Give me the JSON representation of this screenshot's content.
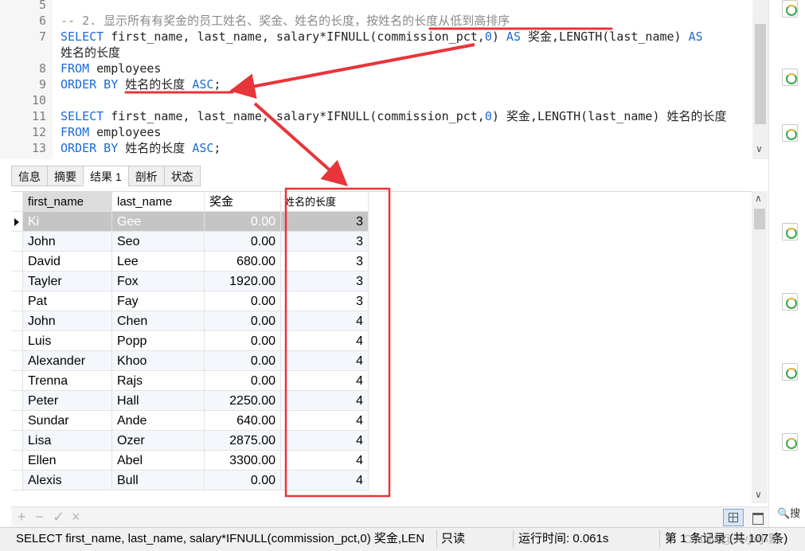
{
  "editor": {
    "lines": [
      {
        "num": "5"
      },
      {
        "num": "6",
        "comment": "-- 2. 显示所有有奖金的员工姓名、奖金、姓名的长度，按姓名的长度从低到高排序"
      },
      {
        "num": "7",
        "kw1": "SELECT",
        "t1": " first_name, last_name, salary*IFNULL(commission_pct,",
        "n1": "0",
        "t2": ") ",
        "kw2": "AS",
        "t3": " 奖金,LENGTH(last_name) ",
        "kw3": "AS"
      },
      {
        "wrap": "姓名的长度"
      },
      {
        "num": "8",
        "kw1": "FROM",
        "t1": " employees"
      },
      {
        "num": "9",
        "kw1": "ORDER BY",
        "t1": " 姓名的长度 ",
        "kw2": "ASC",
        "t2": ";"
      },
      {
        "num": "10"
      },
      {
        "num": "11",
        "kw1": "SELECT",
        "t1": " first_name, last_name, salary*IFNULL(commission_pct,",
        "n1": "0",
        "t2": ") 奖金,LENGTH(last_name) 姓名的长度"
      },
      {
        "num": "12",
        "kw1": "FROM",
        "t1": " employees"
      },
      {
        "num": "13",
        "kw1": "ORDER BY",
        "t1": " 姓名的长度 ",
        "kw2": "ASC",
        "t2": ";"
      }
    ]
  },
  "tabs": [
    "信息",
    "摘要",
    "结果 1",
    "剖析",
    "状态"
  ],
  "active_tab": 2,
  "grid": {
    "columns": [
      "first_name",
      "last_name",
      "奖金",
      "姓名的长度"
    ],
    "rows": [
      [
        "Ki",
        "Gee",
        "0.00",
        "3"
      ],
      [
        "John",
        "Seo",
        "0.00",
        "3"
      ],
      [
        "David",
        "Lee",
        "680.00",
        "3"
      ],
      [
        "Tayler",
        "Fox",
        "1920.00",
        "3"
      ],
      [
        "Pat",
        "Fay",
        "0.00",
        "3"
      ],
      [
        "John",
        "Chen",
        "0.00",
        "4"
      ],
      [
        "Luis",
        "Popp",
        "0.00",
        "4"
      ],
      [
        "Alexander",
        "Khoo",
        "0.00",
        "4"
      ],
      [
        "Trenna",
        "Rajs",
        "0.00",
        "4"
      ],
      [
        "Peter",
        "Hall",
        "2250.00",
        "4"
      ],
      [
        "Sundar",
        "Ande",
        "640.00",
        "4"
      ],
      [
        "Lisa",
        "Ozer",
        "2875.00",
        "4"
      ],
      [
        "Ellen",
        "Abel",
        "3300.00",
        "4"
      ],
      [
        "Alexis",
        "Bull",
        "0.00",
        "4"
      ]
    ]
  },
  "grid_tools": {
    "add": "+",
    "remove": "−",
    "apply": "✓",
    "cancel": "×"
  },
  "right_panel": {
    "search": "🔍搜"
  },
  "status": {
    "query": "SELECT first_name, last_name, salary*IFNULL(commission_pct,0) 奖金,LEN",
    "readonly": "只读",
    "runtime": "运行时间: 0.061s",
    "records": "第 1 条记录 (共 107 条)"
  },
  "watermark": "CSDN @天小小默",
  "colors": {
    "keyword": "#1b6ad6",
    "annotation": "#e8353a",
    "comment": "#8a8a8a"
  }
}
